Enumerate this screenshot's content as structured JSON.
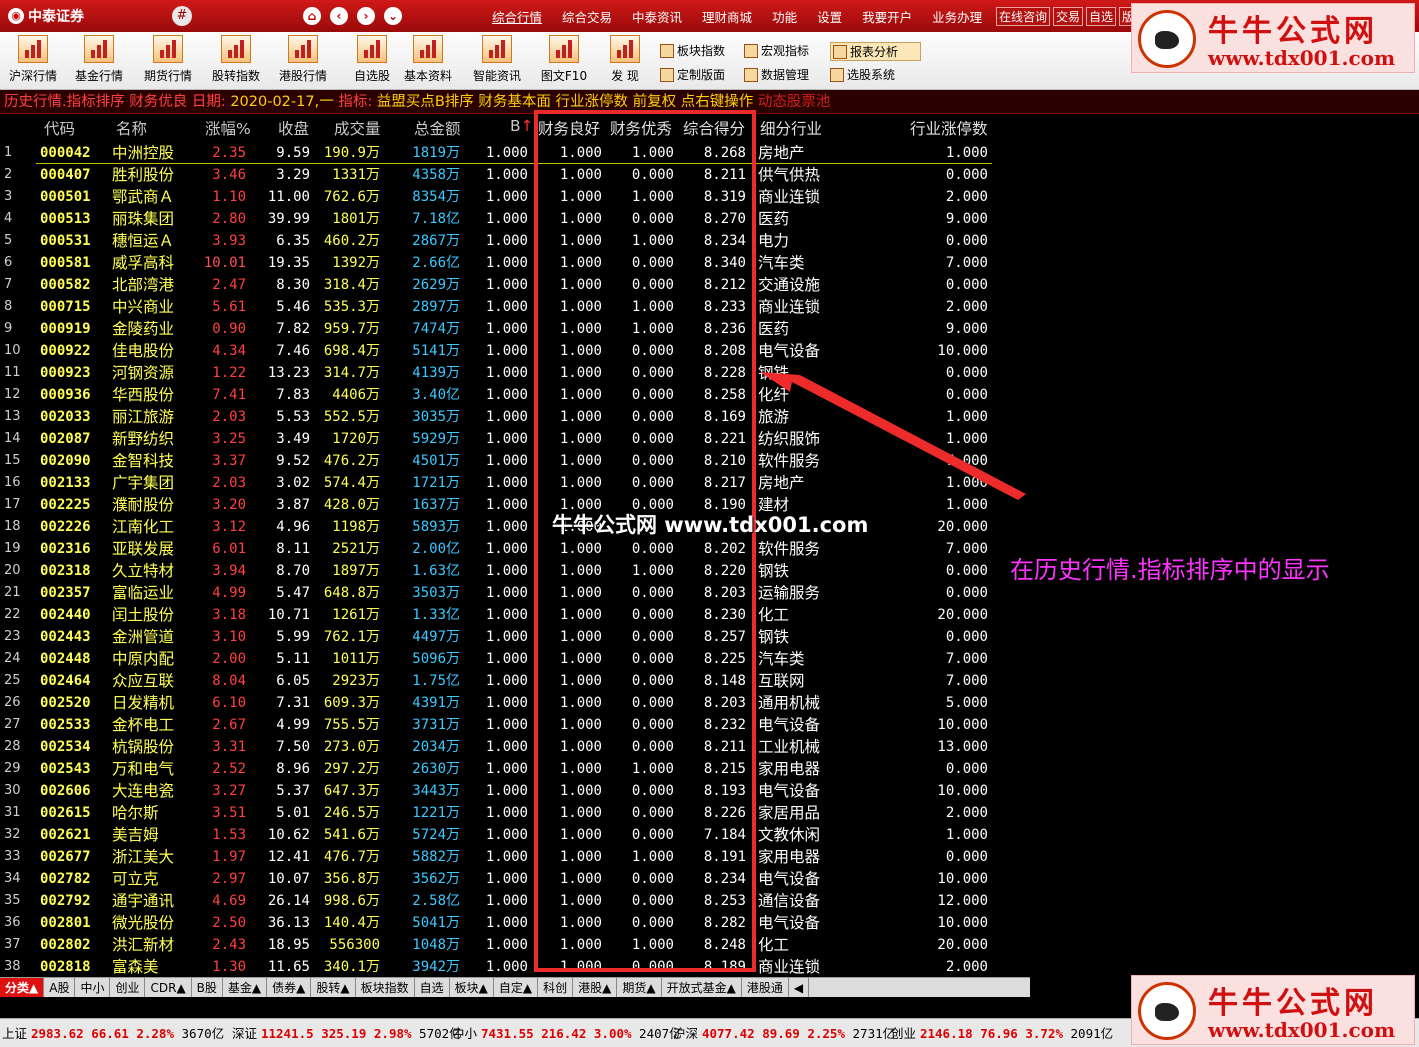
{
  "app": {
    "broker_name": "中泰证券",
    "top_menu": [
      "综合行情",
      "综合交易",
      "中泰资讯",
      "理财商城",
      "功能",
      "设置",
      "我要开户",
      "业务办理"
    ],
    "top_buttons": [
      "在线咨询",
      "交易",
      "自选",
      "版"
    ]
  },
  "toolbar": {
    "tools": [
      "沪深行情",
      "基金行情",
      "期货行情",
      "股转指数",
      "港股行情",
      "自选股",
      "基本资料",
      "智能资讯",
      "图文F10",
      "发 现"
    ],
    "right_tools": [
      "板块指数",
      "宏观指标",
      "报表分析",
      "定制版面",
      "数据管理",
      "选股系统"
    ]
  },
  "info_line": {
    "mode": "历史行情.指标排序",
    "label1": "财务优良",
    "date_label": "日期:",
    "date": "2020-02-17,一",
    "indicator_label": "指标:",
    "indicator": "益盟买点B排序",
    "desc": "财务基本面 行业涨停数",
    "adj": "前复权",
    "hint": "点右键操作",
    "pool": "动态股票池"
  },
  "columns": {
    "code": "代码",
    "name": "名称",
    "pct": "涨幅%",
    "close": "收盘",
    "volume": "成交量",
    "amount": "总金额",
    "b": "B",
    "fin_good": "财务良好",
    "fin_excellent": "财务优秀",
    "score": "综合得分",
    "industry": "细分行业",
    "limit_up": "行业涨停数"
  },
  "rows": [
    {
      "no": "1",
      "code": "000042",
      "name": "中洲控股",
      "pct": "2.35",
      "close": "9.59",
      "vol": "190.9万",
      "amt": "1819万",
      "b": "1.000",
      "f1": "1.000",
      "f2": "1.000",
      "score": "8.268",
      "ind": "房地产",
      "lim": "1.000"
    },
    {
      "no": "2",
      "code": "000407",
      "name": "胜利股份",
      "pct": "3.46",
      "close": "3.29",
      "vol": "1331万",
      "amt": "4358万",
      "b": "1.000",
      "f1": "1.000",
      "f2": "0.000",
      "score": "8.211",
      "ind": "供气供热",
      "lim": "0.000"
    },
    {
      "no": "3",
      "code": "000501",
      "name": "鄂武商Ａ",
      "pct": "1.10",
      "close": "11.00",
      "vol": "762.6万",
      "amt": "8354万",
      "b": "1.000",
      "f1": "1.000",
      "f2": "1.000",
      "score": "8.319",
      "ind": "商业连锁",
      "lim": "2.000"
    },
    {
      "no": "4",
      "code": "000513",
      "name": "丽珠集团",
      "pct": "2.80",
      "close": "39.99",
      "vol": "1801万",
      "amt": "7.18亿",
      "b": "1.000",
      "f1": "1.000",
      "f2": "0.000",
      "score": "8.270",
      "ind": "医药",
      "lim": "9.000"
    },
    {
      "no": "5",
      "code": "000531",
      "name": "穗恒运Ａ",
      "pct": "3.93",
      "close": "6.35",
      "vol": "460.2万",
      "amt": "2867万",
      "b": "1.000",
      "f1": "1.000",
      "f2": "1.000",
      "score": "8.234",
      "ind": "电力",
      "lim": "0.000"
    },
    {
      "no": "6",
      "code": "000581",
      "name": "威孚高科",
      "pct": "10.01",
      "close": "19.35",
      "vol": "1392万",
      "amt": "2.66亿",
      "b": "1.000",
      "f1": "1.000",
      "f2": "0.000",
      "score": "8.340",
      "ind": "汽车类",
      "lim": "7.000"
    },
    {
      "no": "7",
      "code": "000582",
      "name": "北部湾港",
      "pct": "2.47",
      "close": "8.30",
      "vol": "318.4万",
      "amt": "2629万",
      "b": "1.000",
      "f1": "1.000",
      "f2": "0.000",
      "score": "8.212",
      "ind": "交通设施",
      "lim": "0.000"
    },
    {
      "no": "8",
      "code": "000715",
      "name": "中兴商业",
      "pct": "5.61",
      "close": "5.46",
      "vol": "535.3万",
      "amt": "2897万",
      "b": "1.000",
      "f1": "1.000",
      "f2": "1.000",
      "score": "8.233",
      "ind": "商业连锁",
      "lim": "2.000"
    },
    {
      "no": "9",
      "code": "000919",
      "name": "金陵药业",
      "pct": "0.90",
      "close": "7.82",
      "vol": "959.7万",
      "amt": "7474万",
      "b": "1.000",
      "f1": "1.000",
      "f2": "1.000",
      "score": "8.236",
      "ind": "医药",
      "lim": "9.000"
    },
    {
      "no": "10",
      "code": "000922",
      "name": "佳电股份",
      "pct": "4.34",
      "close": "7.46",
      "vol": "698.4万",
      "amt": "5141万",
      "b": "1.000",
      "f1": "1.000",
      "f2": "0.000",
      "score": "8.208",
      "ind": "电气设备",
      "lim": "10.000"
    },
    {
      "no": "11",
      "code": "000923",
      "name": "河钢资源",
      "pct": "1.22",
      "close": "13.23",
      "vol": "314.7万",
      "amt": "4139万",
      "b": "1.000",
      "f1": "1.000",
      "f2": "0.000",
      "score": "8.228",
      "ind": "钢铁",
      "lim": "0.000"
    },
    {
      "no": "12",
      "code": "000936",
      "name": "华西股份",
      "pct": "7.41",
      "close": "7.83",
      "vol": "4406万",
      "amt": "3.40亿",
      "b": "1.000",
      "f1": "1.000",
      "f2": "0.000",
      "score": "8.258",
      "ind": "化纤",
      "lim": "0.000"
    },
    {
      "no": "13",
      "code": "002033",
      "name": "丽江旅游",
      "pct": "2.03",
      "close": "5.53",
      "vol": "552.5万",
      "amt": "3035万",
      "b": "1.000",
      "f1": "1.000",
      "f2": "0.000",
      "score": "8.169",
      "ind": "旅游",
      "lim": "1.000"
    },
    {
      "no": "14",
      "code": "002087",
      "name": "新野纺织",
      "pct": "3.25",
      "close": "3.49",
      "vol": "1720万",
      "amt": "5929万",
      "b": "1.000",
      "f1": "1.000",
      "f2": "0.000",
      "score": "8.221",
      "ind": "纺织服饰",
      "lim": "1.000"
    },
    {
      "no": "15",
      "code": "002090",
      "name": "金智科技",
      "pct": "3.37",
      "close": "9.52",
      "vol": "476.2万",
      "amt": "4501万",
      "b": "1.000",
      "f1": "1.000",
      "f2": "0.000",
      "score": "8.210",
      "ind": "软件服务",
      "lim": "7.000"
    },
    {
      "no": "16",
      "code": "002133",
      "name": "广宇集团",
      "pct": "2.03",
      "close": "3.02",
      "vol": "574.4万",
      "amt": "1721万",
      "b": "1.000",
      "f1": "1.000",
      "f2": "0.000",
      "score": "8.217",
      "ind": "房地产",
      "lim": "1.000"
    },
    {
      "no": "17",
      "code": "002225",
      "name": "濮耐股份",
      "pct": "3.20",
      "close": "3.87",
      "vol": "428.0万",
      "amt": "1637万",
      "b": "1.000",
      "f1": "1.000",
      "f2": "0.000",
      "score": "8.190",
      "ind": "建材",
      "lim": "1.000"
    },
    {
      "no": "18",
      "code": "002226",
      "name": "江南化工",
      "pct": "3.12",
      "close": "4.96",
      "vol": "1198万",
      "amt": "5893万",
      "b": "1.000",
      "f1": "1.000",
      "f2": "",
      "score": "",
      "ind": "",
      "lim": "20.000"
    },
    {
      "no": "19",
      "code": "002316",
      "name": "亚联发展",
      "pct": "6.01",
      "close": "8.11",
      "vol": "2521万",
      "amt": "2.00亿",
      "b": "1.000",
      "f1": "1.000",
      "f2": "0.000",
      "score": "8.202",
      "ind": "软件服务",
      "lim": "7.000"
    },
    {
      "no": "20",
      "code": "002318",
      "name": "久立特材",
      "pct": "3.94",
      "close": "8.70",
      "vol": "1897万",
      "amt": "1.63亿",
      "b": "1.000",
      "f1": "1.000",
      "f2": "1.000",
      "score": "8.220",
      "ind": "钢铁",
      "lim": "0.000"
    },
    {
      "no": "21",
      "code": "002357",
      "name": "富临运业",
      "pct": "4.99",
      "close": "5.47",
      "vol": "648.8万",
      "amt": "3503万",
      "b": "1.000",
      "f1": "1.000",
      "f2": "0.000",
      "score": "8.203",
      "ind": "运输服务",
      "lim": "0.000"
    },
    {
      "no": "22",
      "code": "002440",
      "name": "闰土股份",
      "pct": "3.18",
      "close": "10.71",
      "vol": "1261万",
      "amt": "1.33亿",
      "b": "1.000",
      "f1": "1.000",
      "f2": "0.000",
      "score": "8.230",
      "ind": "化工",
      "lim": "20.000"
    },
    {
      "no": "23",
      "code": "002443",
      "name": "金洲管道",
      "pct": "3.10",
      "close": "5.99",
      "vol": "762.1万",
      "amt": "4497万",
      "b": "1.000",
      "f1": "1.000",
      "f2": "0.000",
      "score": "8.257",
      "ind": "钢铁",
      "lim": "0.000"
    },
    {
      "no": "24",
      "code": "002448",
      "name": "中原内配",
      "pct": "2.00",
      "close": "5.11",
      "vol": "1011万",
      "amt": "5096万",
      "b": "1.000",
      "f1": "1.000",
      "f2": "0.000",
      "score": "8.225",
      "ind": "汽车类",
      "lim": "7.000"
    },
    {
      "no": "25",
      "code": "002464",
      "name": "众应互联",
      "pct": "8.04",
      "close": "6.05",
      "vol": "2923万",
      "amt": "1.75亿",
      "b": "1.000",
      "f1": "1.000",
      "f2": "0.000",
      "score": "8.148",
      "ind": "互联网",
      "lim": "7.000"
    },
    {
      "no": "26",
      "code": "002520",
      "name": "日发精机",
      "pct": "6.10",
      "close": "7.31",
      "vol": "609.3万",
      "amt": "4391万",
      "b": "1.000",
      "f1": "1.000",
      "f2": "0.000",
      "score": "8.203",
      "ind": "通用机械",
      "lim": "5.000"
    },
    {
      "no": "27",
      "code": "002533",
      "name": "金杯电工",
      "pct": "2.67",
      "close": "4.99",
      "vol": "755.5万",
      "amt": "3731万",
      "b": "1.000",
      "f1": "1.000",
      "f2": "0.000",
      "score": "8.232",
      "ind": "电气设备",
      "lim": "10.000"
    },
    {
      "no": "28",
      "code": "002534",
      "name": "杭锅股份",
      "pct": "3.31",
      "close": "7.50",
      "vol": "273.0万",
      "amt": "2034万",
      "b": "1.000",
      "f1": "1.000",
      "f2": "0.000",
      "score": "8.211",
      "ind": "工业机械",
      "lim": "13.000"
    },
    {
      "no": "29",
      "code": "002543",
      "name": "万和电气",
      "pct": "2.52",
      "close": "8.96",
      "vol": "297.2万",
      "amt": "2630万",
      "b": "1.000",
      "f1": "1.000",
      "f2": "1.000",
      "score": "8.215",
      "ind": "家用电器",
      "lim": "0.000"
    },
    {
      "no": "30",
      "code": "002606",
      "name": "大连电瓷",
      "pct": "3.27",
      "close": "5.37",
      "vol": "647.3万",
      "amt": "3443万",
      "b": "1.000",
      "f1": "1.000",
      "f2": "0.000",
      "score": "8.193",
      "ind": "电气设备",
      "lim": "10.000"
    },
    {
      "no": "31",
      "code": "002615",
      "name": "哈尔斯",
      "pct": "3.51",
      "close": "5.01",
      "vol": "246.5万",
      "amt": "1221万",
      "b": "1.000",
      "f1": "1.000",
      "f2": "0.000",
      "score": "8.226",
      "ind": "家居用品",
      "lim": "2.000"
    },
    {
      "no": "32",
      "code": "002621",
      "name": "美吉姆",
      "pct": "1.53",
      "close": "10.62",
      "vol": "541.6万",
      "amt": "5724万",
      "b": "1.000",
      "f1": "1.000",
      "f2": "0.000",
      "score": "7.184",
      "ind": "文教休闲",
      "lim": "1.000"
    },
    {
      "no": "33",
      "code": "002677",
      "name": "浙江美大",
      "pct": "1.97",
      "close": "12.41",
      "vol": "476.7万",
      "amt": "5882万",
      "b": "1.000",
      "f1": "1.000",
      "f2": "1.000",
      "score": "8.191",
      "ind": "家用电器",
      "lim": "0.000"
    },
    {
      "no": "34",
      "code": "002782",
      "name": "可立克",
      "pct": "2.97",
      "close": "10.07",
      "vol": "356.8万",
      "amt": "3562万",
      "b": "1.000",
      "f1": "1.000",
      "f2": "0.000",
      "score": "8.234",
      "ind": "电气设备",
      "lim": "10.000"
    },
    {
      "no": "35",
      "code": "002792",
      "name": "通宇通讯",
      "pct": "4.69",
      "close": "26.14",
      "vol": "998.6万",
      "amt": "2.58亿",
      "b": "1.000",
      "f1": "1.000",
      "f2": "0.000",
      "score": "8.253",
      "ind": "通信设备",
      "lim": "12.000"
    },
    {
      "no": "36",
      "code": "002801",
      "name": "微光股份",
      "pct": "2.50",
      "close": "36.13",
      "vol": "140.4万",
      "amt": "5041万",
      "b": "1.000",
      "f1": "1.000",
      "f2": "0.000",
      "score": "8.282",
      "ind": "电气设备",
      "lim": "10.000"
    },
    {
      "no": "37",
      "code": "002802",
      "name": "洪汇新材",
      "pct": "2.43",
      "close": "18.95",
      "vol": "556300",
      "amt": "1048万",
      "b": "1.000",
      "f1": "1.000",
      "f2": "1.000",
      "score": "8.248",
      "ind": "化工",
      "lim": "20.000"
    },
    {
      "no": "38",
      "code": "002818",
      "name": "富森美",
      "pct": "1.30",
      "close": "11.65",
      "vol": "340.1万",
      "amt": "3942万",
      "b": "1.000",
      "f1": "1.000",
      "f2": "0.000",
      "score": "8.189",
      "ind": "商业连锁",
      "lim": "2.000"
    }
  ],
  "overlay": {
    "watermark_mid": "牛牛公式网 www.tdx001.com",
    "annotation": "在历史行情.指标排序中的显示",
    "stamp_cn": "牛牛公式网",
    "stamp_url": "www.tdx001.com",
    "colors": {
      "box": "#ee2b2b",
      "annotation": "#ff33ff"
    }
  },
  "bottom_tabs": [
    "分类▲",
    "A股",
    "中小",
    "创业",
    "CDR▲",
    "B股",
    "基金▲",
    "债券▲",
    "股转▲",
    "板块指数",
    "自选",
    "板块▲",
    "自定▲",
    "科创",
    "港股▲",
    "期货▲",
    "开放式基金▲",
    "港股通"
  ],
  "status": [
    {
      "name": "上证",
      "price": "2983.62",
      "chg": "66.61",
      "pct": "2.28%",
      "amt": "3670亿"
    },
    {
      "name": "深证",
      "price": "11241.5",
      "chg": "325.19",
      "pct": "2.98%",
      "amt": "5702亿"
    },
    {
      "name": "中小",
      "price": "7431.55",
      "chg": "216.42",
      "pct": "3.00%",
      "amt": "2407亿"
    },
    {
      "name": "沪深",
      "price": "4077.42",
      "chg": "89.69",
      "pct": "2.25%",
      "amt": "2731亿"
    },
    {
      "name": "创业",
      "price": "2146.18",
      "chg": "76.96",
      "pct": "3.72%",
      "amt": "2091亿"
    }
  ]
}
